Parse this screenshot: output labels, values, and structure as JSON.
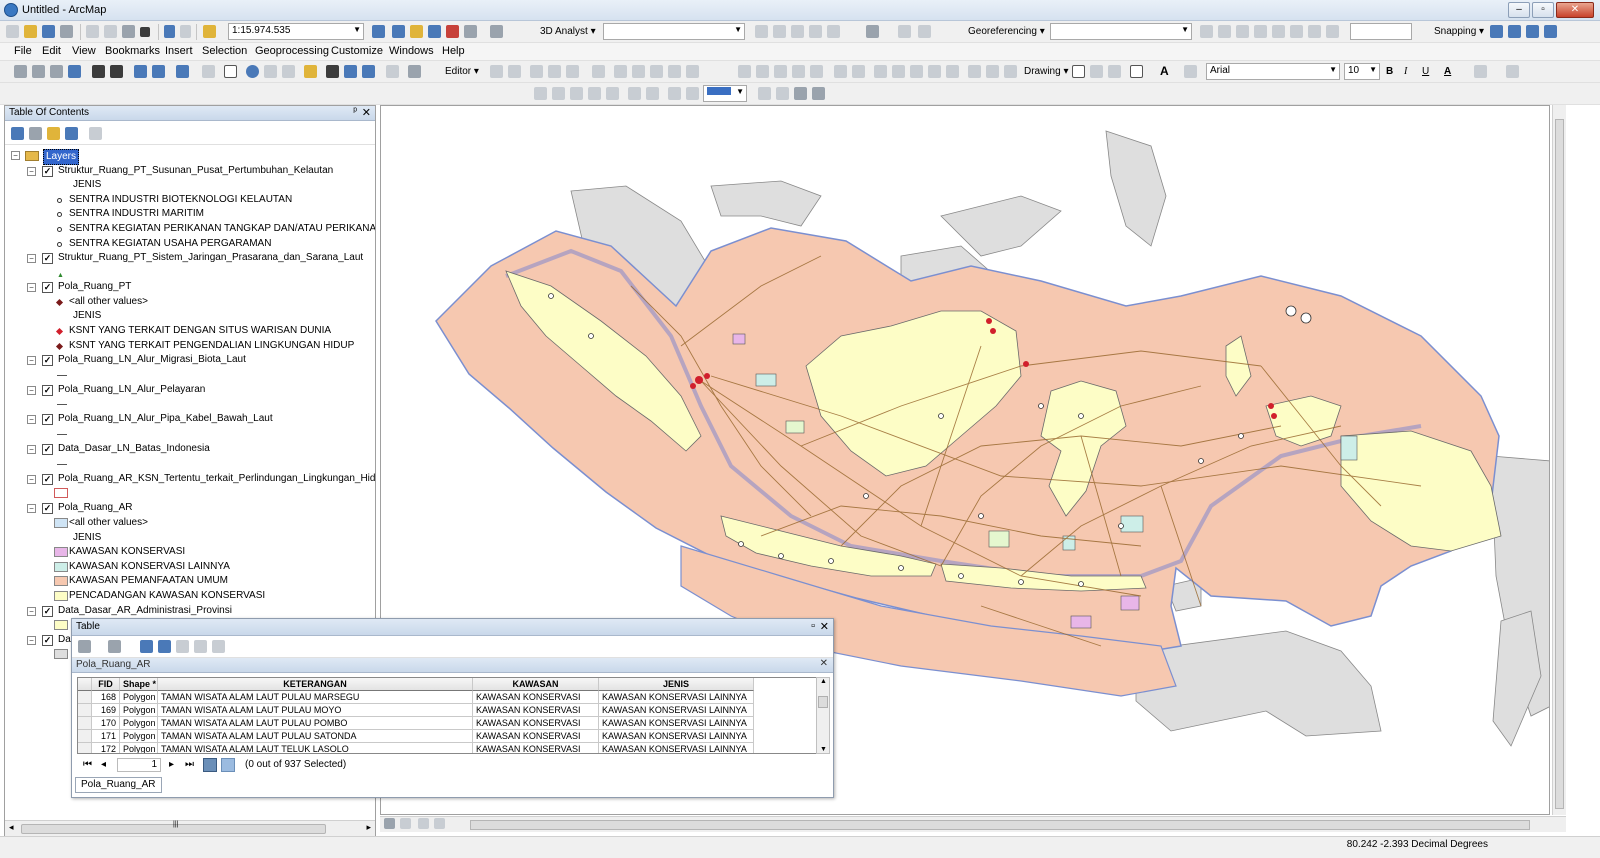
{
  "app": {
    "title": "Untitled - ArcMap"
  },
  "menu": [
    "File",
    "Edit",
    "View",
    "Bookmarks",
    "Insert",
    "Selection",
    "Geoprocessing",
    "Customize",
    "Windows",
    "Help"
  ],
  "toolbar": {
    "scale": "1:15.974.535",
    "analyst_3d": "3D Analyst ▾",
    "georeferencing": "Georeferencing ▾",
    "snapping": "Snapping ▾",
    "editor": "Editor ▾",
    "drawing": "Drawing ▾",
    "font_name": "Arial",
    "font_size": "10",
    "bold": "B",
    "italic": "I",
    "underline": "U",
    "text_tool": "A"
  },
  "toc": {
    "title": "Table Of Contents",
    "pin": "ᵖ",
    "close": "✕",
    "root": "Layers",
    "items": [
      {
        "kind": "layer",
        "label": "Struktur_Ruang_PT_Susunan_Pusat_Pertumbuhan_Kelautan"
      },
      {
        "kind": "heading",
        "label": "JENIS"
      },
      {
        "kind": "point",
        "label": "SENTRA INDUSTRI BIOTEKNOLOGI KELAUTAN"
      },
      {
        "kind": "point",
        "label": "SENTRA INDUSTRI MARITIM"
      },
      {
        "kind": "point",
        "label": "SENTRA KEGIATAN PERIKANAN TANGKAP DAN/ATAU PERIKANAN BU"
      },
      {
        "kind": "point",
        "label": "SENTRA KEGIATAN USAHA PERGARAMAN"
      },
      {
        "kind": "layer",
        "label": "Struktur_Ruang_PT_Sistem_Jaringan_Prasarana_dan_Sarana_Laut"
      },
      {
        "kind": "tri",
        "label": ""
      },
      {
        "kind": "layer",
        "label": "Pola_Ruang_PT"
      },
      {
        "kind": "diamond",
        "label": "<all other values>"
      },
      {
        "kind": "heading",
        "label": "JENIS"
      },
      {
        "kind": "diamond-red",
        "label": "KSNT YANG TERKAIT DENGAN SITUS WARISAN DUNIA"
      },
      {
        "kind": "diamond",
        "label": "KSNT YANG TERKAIT PENGENDALIAN LINGKUNGAN HIDUP"
      },
      {
        "kind": "layer",
        "label": "Pola_Ruang_LN_Alur_Migrasi_Biota_Laut"
      },
      {
        "kind": "line",
        "label": ""
      },
      {
        "kind": "layer",
        "label": "Pola_Ruang_LN_Alur_Pelayaran"
      },
      {
        "kind": "line",
        "label": ""
      },
      {
        "kind": "layer",
        "label": "Pola_Ruang_LN_Alur_Pipa_Kabel_Bawah_Laut"
      },
      {
        "kind": "line",
        "label": ""
      },
      {
        "kind": "layer",
        "label": "Data_Dasar_LN_Batas_Indonesia"
      },
      {
        "kind": "line",
        "label": ""
      },
      {
        "kind": "layer",
        "label": "Pola_Ruang_AR_KSN_Tertentu_terkait_Perlindungan_Lingkungan_Hidup"
      },
      {
        "kind": "poly-empty",
        "label": ""
      },
      {
        "kind": "layer",
        "label": "Pola_Ruang_AR"
      },
      {
        "kind": "poly-blue",
        "label": "<all other values>"
      },
      {
        "kind": "heading",
        "label": "JENIS"
      },
      {
        "kind": "poly-pink",
        "label": "KAWASAN KONSERVASI"
      },
      {
        "kind": "poly-cyan",
        "label": "KAWASAN KONSERVASI LAINNYA"
      },
      {
        "kind": "poly-salmon",
        "label": "KAWASAN PEMANFAATAN UMUM"
      },
      {
        "kind": "poly-yellow",
        "label": "PENCADANGAN KAWASAN KONSERVASI"
      },
      {
        "kind": "layer",
        "label": "Data_Dasar_AR_Administrasi_Provinsi"
      },
      {
        "kind": "poly-yellow",
        "label": ""
      },
      {
        "kind": "layer",
        "label": "Da"
      },
      {
        "kind": "poly-grey",
        "label": ""
      }
    ]
  },
  "table": {
    "title": "Table",
    "layer_tab": "Pola_Ruang_AR",
    "columns": [
      "FID",
      "Shape *",
      "KETERANGAN",
      "KAWASAN",
      "JENIS"
    ],
    "rows": [
      [
        "168",
        "Polygon",
        "TAMAN WISATA ALAM LAUT PULAU MARSEGU",
        "KAWASAN KONSERVASI",
        "KAWASAN KONSERVASI LAINNYA"
      ],
      [
        "169",
        "Polygon",
        "TAMAN WISATA ALAM LAUT PULAU MOYO",
        "KAWASAN KONSERVASI",
        "KAWASAN KONSERVASI LAINNYA"
      ],
      [
        "170",
        "Polygon",
        "TAMAN WISATA ALAM LAUT PULAU POMBO",
        "KAWASAN KONSERVASI",
        "KAWASAN KONSERVASI LAINNYA"
      ],
      [
        "171",
        "Polygon",
        "TAMAN WISATA ALAM LAUT PULAU SATONDA",
        "KAWASAN KONSERVASI",
        "KAWASAN KONSERVASI LAINNYA"
      ],
      [
        "172",
        "Polygon",
        "TAMAN WISATA ALAM LAUT TELUK LASOLO",
        "KAWASAN KONSERVASI",
        "KAWASAN KONSERVASI LAINNYA"
      ]
    ],
    "record": "1",
    "selection": "(0 out of 937 Selected)"
  },
  "status": {
    "coords": "80.242  -2.393 Decimal Degrees"
  },
  "colors": {
    "sea_zone": "#f6c8b0",
    "land": "#fdfdc6",
    "neighbor_land": "#dedede",
    "routes": "#9a6a30",
    "boundary": "#7b8fd0"
  },
  "icons": [
    "new-icon",
    "open-icon",
    "save-icon",
    "print-icon",
    "cut-icon",
    "copy-icon",
    "paste-icon",
    "delete-icon",
    "undo-icon",
    "redo-icon",
    "add-data-icon",
    "zoom-in-icon",
    "zoom-out-icon",
    "pan-icon",
    "full-extent-icon",
    "identify-icon",
    "select-icon",
    "find-icon"
  ]
}
